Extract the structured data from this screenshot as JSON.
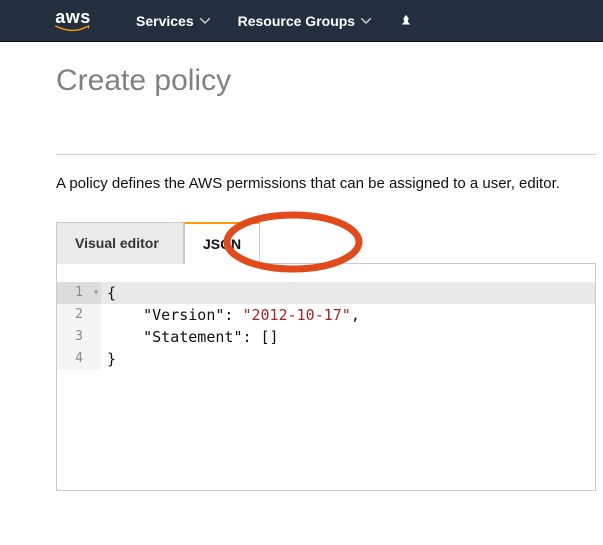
{
  "nav": {
    "logo_text": "aws",
    "services_label": "Services",
    "resource_groups_label": "Resource Groups"
  },
  "page": {
    "title": "Create policy",
    "description": "A policy defines the AWS permissions that can be assigned to a user, editor."
  },
  "tabs": {
    "visual_editor": "Visual editor",
    "json": "JSON"
  },
  "editor": {
    "lines": [
      {
        "n": "1",
        "fold": "▾",
        "segments": [
          {
            "t": "{",
            "c": "punc"
          }
        ]
      },
      {
        "n": "2",
        "fold": "",
        "segments": [
          {
            "t": "    \"",
            "c": "punc"
          },
          {
            "t": "Version",
            "c": "key"
          },
          {
            "t": "\": ",
            "c": "punc"
          },
          {
            "t": "\"2012-10-17\"",
            "c": "str"
          },
          {
            "t": ",",
            "c": "punc"
          }
        ]
      },
      {
        "n": "3",
        "fold": "",
        "segments": [
          {
            "t": "    \"",
            "c": "punc"
          },
          {
            "t": "Statement",
            "c": "key"
          },
          {
            "t": "\": ",
            "c": "punc"
          },
          {
            "t": "[]",
            "c": "punc"
          }
        ]
      },
      {
        "n": "4",
        "fold": "",
        "segments": [
          {
            "t": "}",
            "c": "punc"
          }
        ]
      }
    ]
  }
}
